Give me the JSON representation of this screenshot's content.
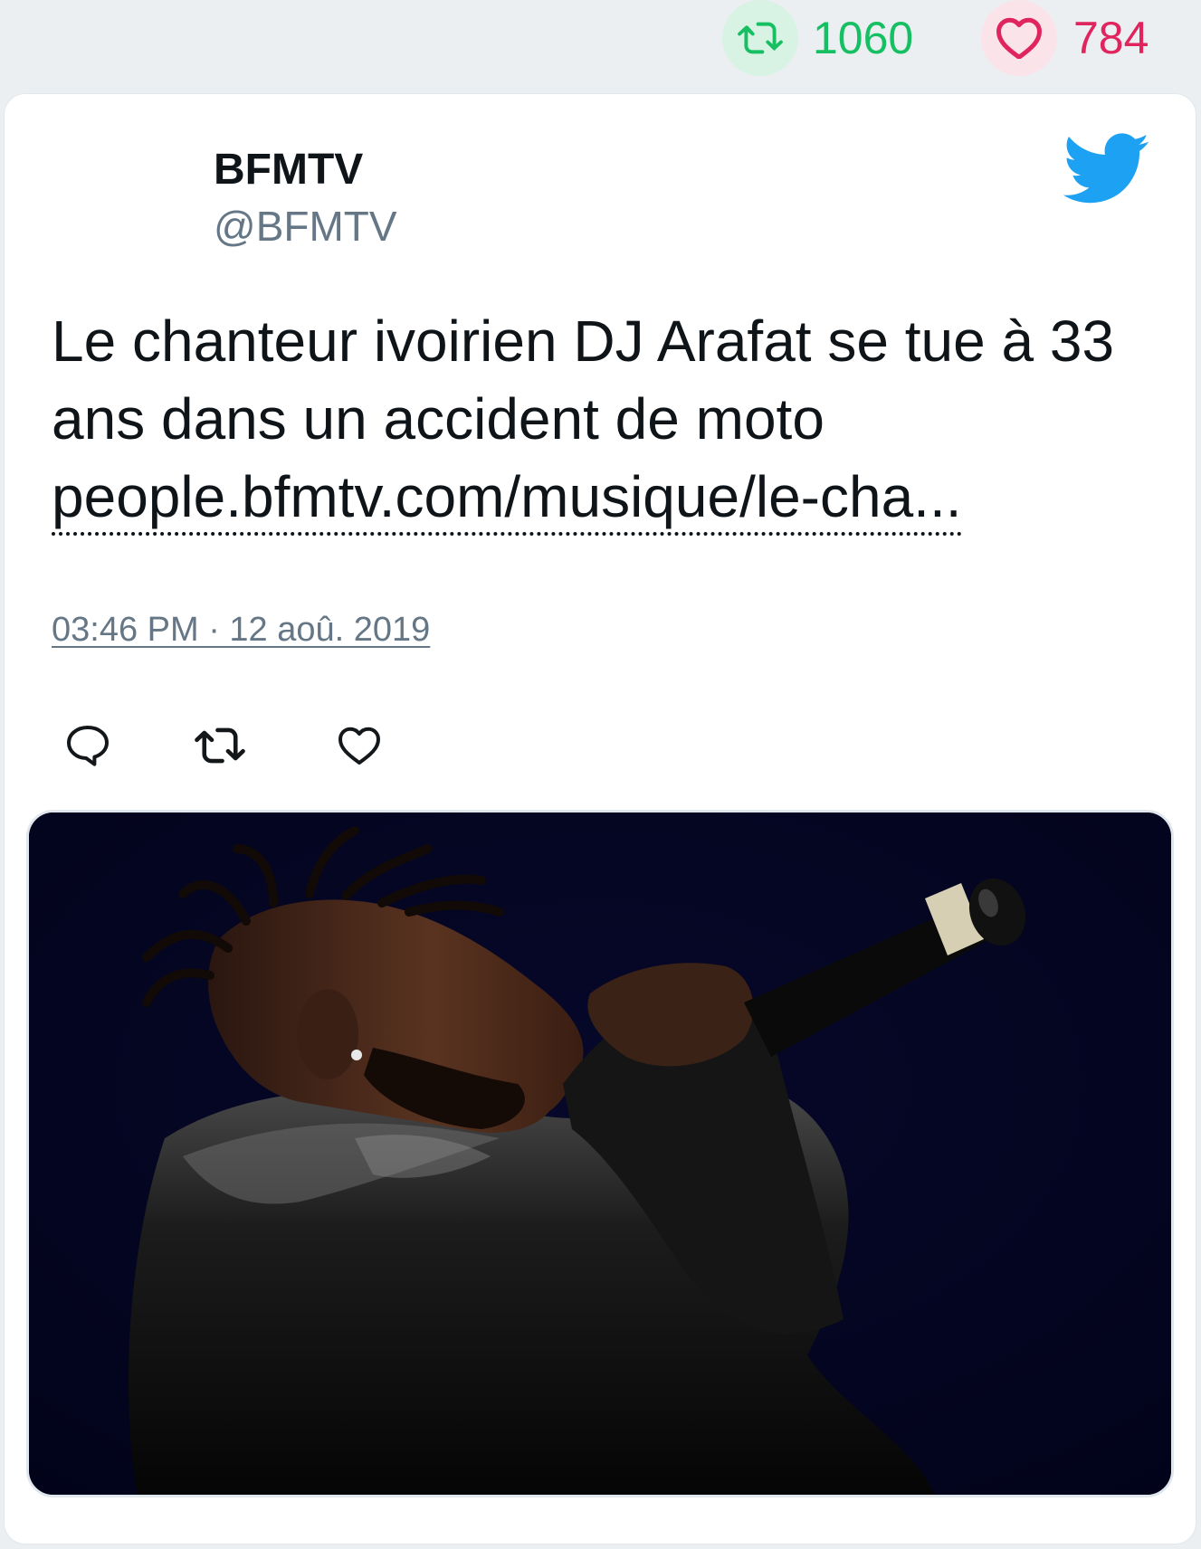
{
  "stats": {
    "retweets": {
      "count": "1060",
      "icon": "retweet-icon",
      "color": "#17bf63"
    },
    "likes": {
      "count": "784",
      "icon": "heart-icon",
      "color": "#e0245e"
    }
  },
  "tweet": {
    "author_name": "BFMTV",
    "author_handle": "@BFMTV",
    "text_line": "Le chanteur ivoirien DJ Arafat se tue à 33 ans dans un accident de moto",
    "link": "people.bfmtv.com/musique/le-cha...",
    "timestamp": "03:46 PM · 12 aoû. 2019",
    "brand_icon": "twitter-bird-icon",
    "brand_color": "#1da1f2"
  },
  "actions": {
    "reply_icon": "reply-icon",
    "retweet_icon": "retweet-icon",
    "like_icon": "heart-icon"
  },
  "media": {
    "subject": "concert-photo"
  }
}
